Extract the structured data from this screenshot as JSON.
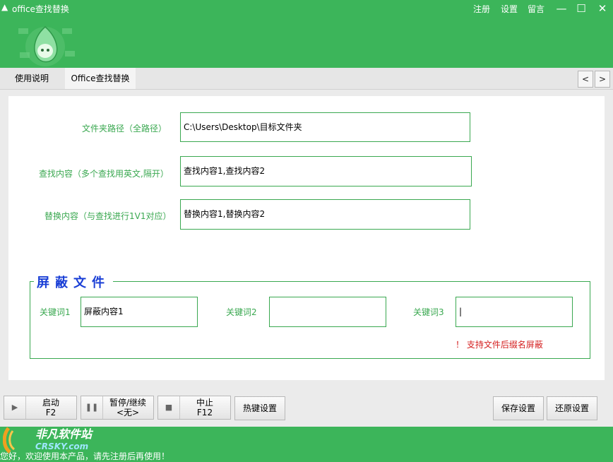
{
  "window": {
    "title": "office查找替换",
    "links": [
      "注册",
      "设置",
      "留言"
    ],
    "buttons": {
      "minimize": "—",
      "maximize": "☐",
      "close": "✕"
    }
  },
  "tabs": [
    {
      "label": "使用说明",
      "active": false
    },
    {
      "label": "Office查找替换",
      "active": true
    }
  ],
  "nav": {
    "prev": "<",
    "next": ">"
  },
  "form": {
    "folder_label": "文件夹路径（全路径）",
    "folder_value": "C:\\Users\\Desktop\\目标文件夹",
    "find_label": "查找内容（多个查找用英文,隔开）",
    "find_value": "查找内容1,查找内容2",
    "replace_label": "替换内容（与查找进行1V1对应）",
    "replace_value": "替换内容1,替换内容2"
  },
  "shield": {
    "title": "屏蔽文件",
    "keyword1_label": "关键词1",
    "keyword1_value": "屏蔽内容1",
    "keyword2_label": "关键词2",
    "keyword2_value": "",
    "keyword3_label": "关键词3",
    "keyword3_value": "|",
    "warning": "！ 支持文件后缀名屏蔽"
  },
  "toolbar": {
    "start_label": "启动",
    "start_key": "F2",
    "pause_label": "暂停/继续",
    "pause_key": "<无>",
    "stop_label": "中止",
    "stop_key": "F12",
    "hotkey_label": "热键设置",
    "save_label": "保存设置",
    "restore_label": "还原设置"
  },
  "footer": {
    "logo_cn": "非凡软件站",
    "logo_en": "CRSKY.com",
    "status": "您好，欢迎使用本产品，请先注册后再使用！"
  },
  "colors": {
    "accent": "#3cb55a",
    "label": "#3aa850",
    "group_title": "#1a3fd6",
    "warning": "#d42020"
  }
}
